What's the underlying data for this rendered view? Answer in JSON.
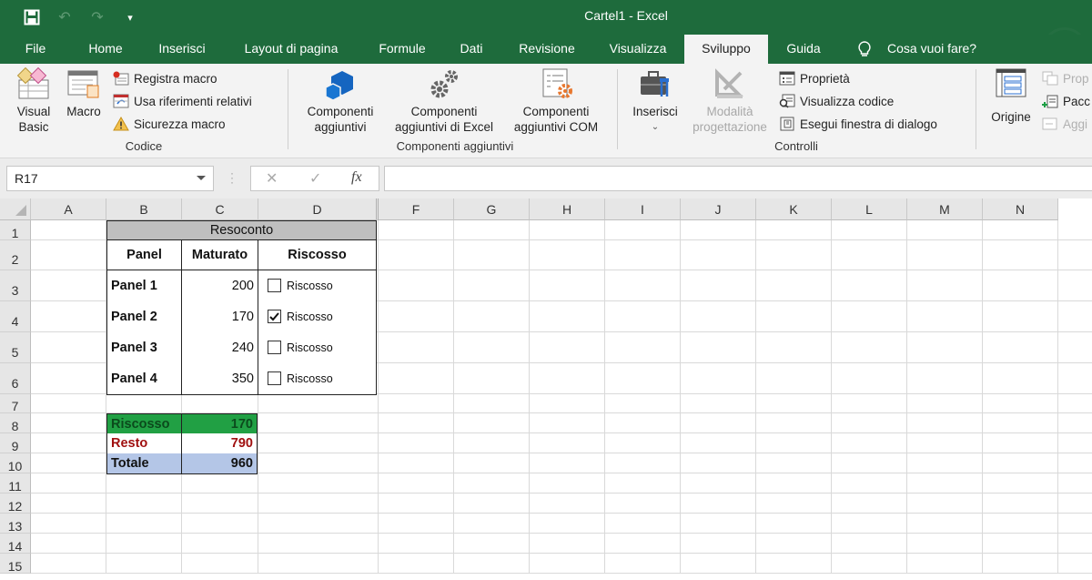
{
  "window": {
    "title": "Cartel1  -  Excel"
  },
  "quick_access": {
    "save_icon": "save-icon",
    "undo_icon": "undo-icon",
    "redo_icon": "redo-icon",
    "customize_icon": "customize-qat-icon"
  },
  "tabs": [
    {
      "label": "File"
    },
    {
      "label": "Home"
    },
    {
      "label": "Inserisci"
    },
    {
      "label": "Layout di pagina"
    },
    {
      "label": "Formule"
    },
    {
      "label": "Dati"
    },
    {
      "label": "Revisione"
    },
    {
      "label": "Visualizza"
    },
    {
      "label": "Sviluppo",
      "active": true
    },
    {
      "label": "Guida"
    }
  ],
  "tell_me": "Cosa vuoi fare?",
  "ribbon": {
    "codice": {
      "label": "Codice",
      "visual_basic": "Visual\nBasic",
      "visual_basic_l1": "Visual",
      "visual_basic_l2": "Basic",
      "macro": "Macro",
      "registra_macro": "Registra macro",
      "usa_riferimenti": "Usa riferimenti relativi",
      "sicurezza_macro": "Sicurezza macro"
    },
    "componenti": {
      "label": "Componenti aggiuntivi",
      "comp_l1": "Componenti",
      "comp_l2": "aggiuntivi",
      "excel_l1": "Componenti",
      "excel_l2": "aggiuntivi di Excel",
      "com_l1": "Componenti",
      "com_l2": "aggiuntivi COM"
    },
    "controlli": {
      "label": "Controlli",
      "inserisci": "Inserisci",
      "modalita_l1": "Modalità",
      "modalita_l2": "progettazione",
      "proprieta": "Proprietà",
      "visualizza_codice": "Visualizza codice",
      "esegui_finestra": "Esegui finestra di dialogo"
    },
    "xml": {
      "origine": "Origine",
      "prop": "Prop",
      "pacc": "Pacc",
      "aggi": "Aggi"
    }
  },
  "formula_bar": {
    "name_box": "R17",
    "cancel_icon": "✕",
    "enter_icon": "✓",
    "fx_label": "fx",
    "formula": ""
  },
  "sheet": {
    "columns": [
      "A",
      "B",
      "C",
      "D",
      "F",
      "G",
      "H",
      "I",
      "J",
      "K",
      "L",
      "M",
      "N"
    ],
    "rows": [
      "1",
      "2",
      "3",
      "4",
      "5",
      "6",
      "7",
      "8",
      "9",
      "10",
      "11",
      "12",
      "13",
      "14",
      "15"
    ],
    "report": {
      "title": "Resoconto",
      "headers": [
        "Panel",
        "Maturato",
        "Riscosso"
      ],
      "items": [
        {
          "panel": "Panel 1",
          "maturato": "200",
          "checkbox_label": "Riscosso",
          "checked": false
        },
        {
          "panel": "Panel 2",
          "maturato": "170",
          "checkbox_label": "Riscosso",
          "checked": true
        },
        {
          "panel": "Panel 3",
          "maturato": "240",
          "checkbox_label": "Riscosso",
          "checked": false
        },
        {
          "panel": "Panel 4",
          "maturato": "350",
          "checkbox_label": "Riscosso",
          "checked": false
        }
      ]
    },
    "summary": [
      {
        "label": "Riscosso",
        "value": "170",
        "bg": "#21a044",
        "color": "#0b4a1c"
      },
      {
        "label": "Resto",
        "value": "790",
        "bg": "#ffffff",
        "color": "#a01010"
      },
      {
        "label": "Totale",
        "value": "960",
        "bg": "#b4c6e7",
        "color": "#111111"
      }
    ]
  },
  "colors": {
    "excel_green": "#1e6b3c",
    "header_gray": "#bfbfbf"
  }
}
